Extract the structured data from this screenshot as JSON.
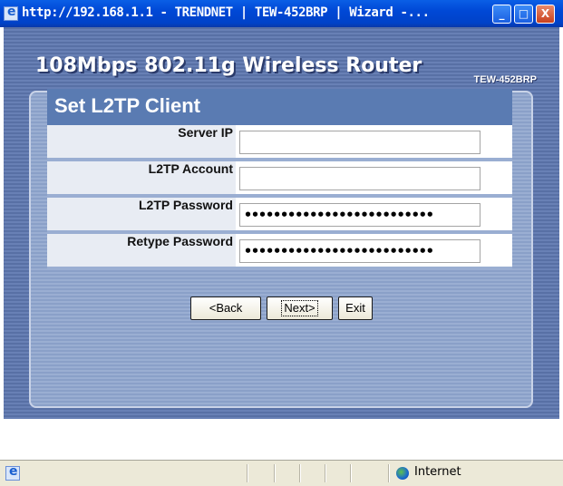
{
  "window": {
    "title": "http://192.168.1.1 - TRENDNET | TEW-452BRP | Wizard -...",
    "minimize": "_",
    "maximize": "□",
    "close": "X"
  },
  "header": {
    "title": "108Mbps 802.11g Wireless Router",
    "model": "TEW-452BRP"
  },
  "form": {
    "title": "Set L2TP Client",
    "fields": [
      {
        "label": "Server IP",
        "value": ""
      },
      {
        "label": "L2TP Account",
        "value": ""
      },
      {
        "label": "L2TP Password",
        "value": "••••••••••••••••••••••••••"
      },
      {
        "label": "Retype Password",
        "value": "••••••••••••••••••••••••••"
      }
    ]
  },
  "buttons": {
    "back": "<Back",
    "next": "Next>",
    "exit": "Exit"
  },
  "status": {
    "zone": "Internet"
  },
  "colors": {
    "title_bar": "#0048d6",
    "banner": "#5870a5",
    "form_header": "#5a7bb2",
    "row_bg": "#e8ecf3"
  }
}
